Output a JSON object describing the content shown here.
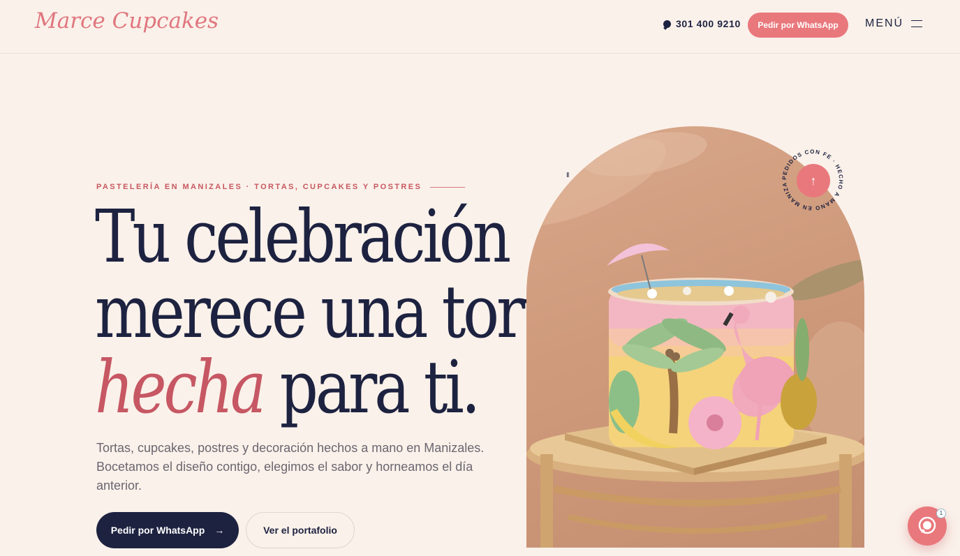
{
  "header": {
    "logo": "Marce Cupcakes",
    "phone": "301 400 9210",
    "cta": "Pedir por WhatsApp",
    "menu_label": "MENÚ"
  },
  "hero": {
    "eyebrow": "PASTELERÍA EN MANIZALES · TORTAS, CUPCAKES Y POSTRES",
    "headline_line1": "Tu celebración",
    "headline_line2": "merece una torta",
    "headline_accent": "hecha",
    "headline_line3_rest": " para ti.",
    "lead": "Tortas, cupcakes, postres y decoración hechos a mano en Manizales. Bocetamos el diseño contigo, elegimos el sabor y horneamos el día anterior.",
    "primary_cta": "Pedir por WhatsApp",
    "primary_cta_arrow": "→",
    "secondary_cta": "Ver el portafolio"
  },
  "media": {
    "pause_symbol": "II",
    "badge_text": "PEDIDOS CON FE · HECHO A MANO EN MANIZALES ✱",
    "badge_arrow": "↑"
  },
  "chat": {
    "unread_count": "1"
  },
  "colors": {
    "background": "#faf1ea",
    "navy": "#1d2240",
    "pink": "#e9787c",
    "accent_rose": "#c65763"
  }
}
